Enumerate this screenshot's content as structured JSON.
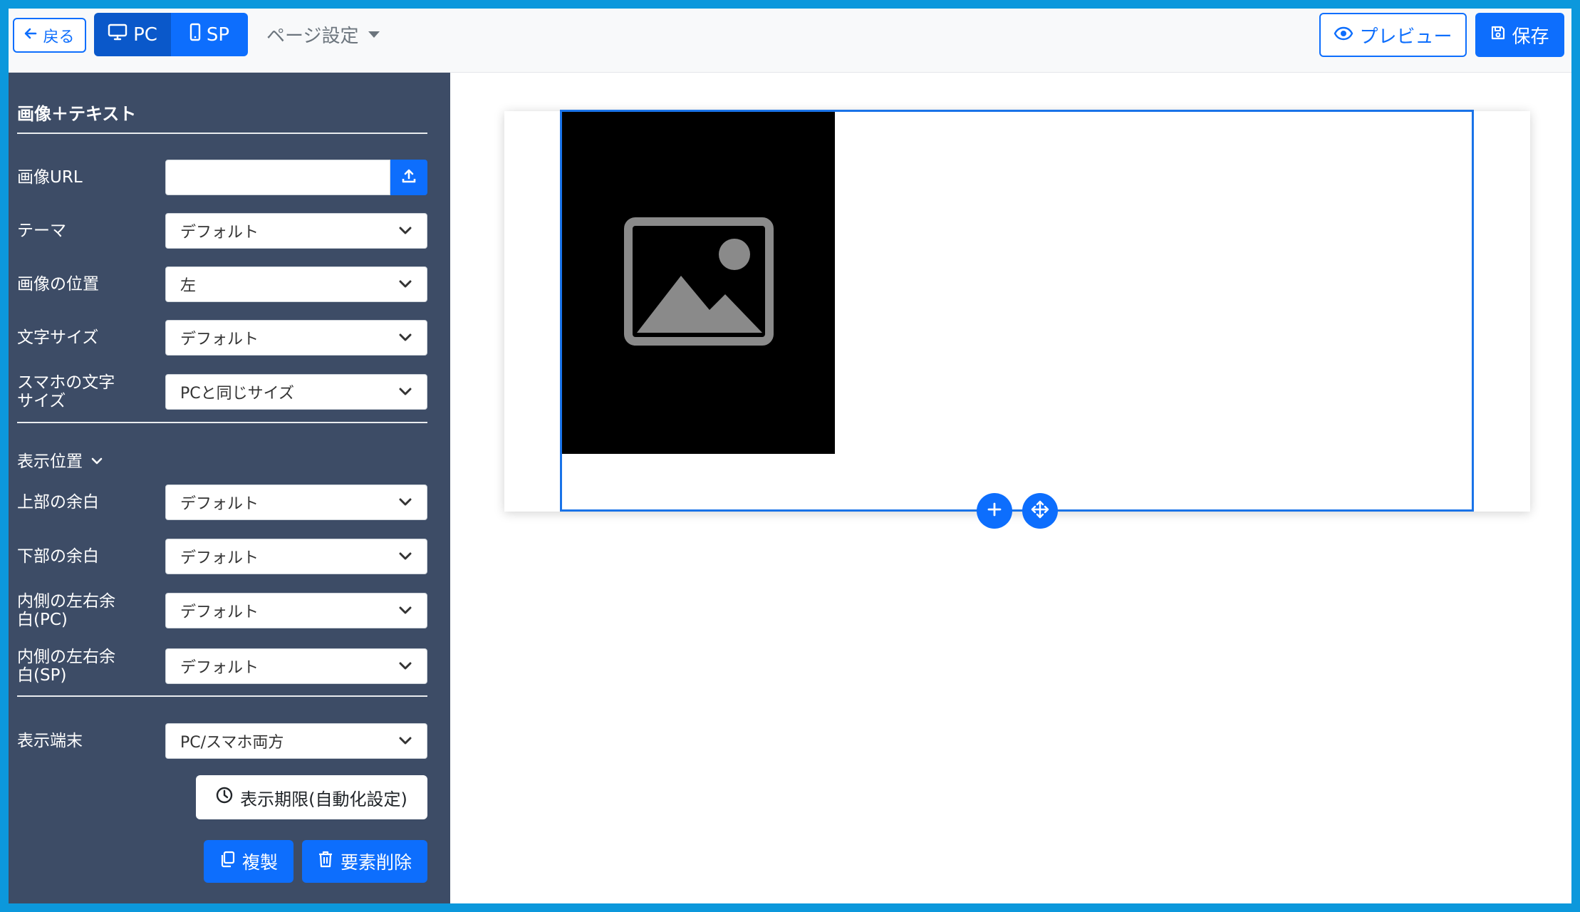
{
  "topbar": {
    "back_label": "戻る",
    "device_pc": "PC",
    "device_sp": "SP",
    "page_settings": "ページ設定",
    "preview_label": "プレビュー",
    "save_label": "保存"
  },
  "sidebar": {
    "title": "画像＋テキスト",
    "image_url": {
      "label": "画像URL",
      "value": ""
    },
    "theme": {
      "label": "テーマ",
      "value": "デフォルト"
    },
    "image_position": {
      "label": "画像の位置",
      "value": "左"
    },
    "font_size": {
      "label": "文字サイズ",
      "value": "デフォルト"
    },
    "sp_font_size": {
      "label": "スマホの文字サイズ",
      "value": "PCと同じサイズ"
    },
    "display_section": "表示位置",
    "top_margin": {
      "label": "上部の余白",
      "value": "デフォルト"
    },
    "bottom_margin": {
      "label": "下部の余白",
      "value": "デフォルト"
    },
    "inner_margin_pc": {
      "label": "内側の左右余白(PC)",
      "value": "デフォルト"
    },
    "inner_margin_sp": {
      "label": "内側の左右余白(SP)",
      "value": "デフォルト"
    },
    "display_device": {
      "label": "表示端末",
      "value": "PC/スマホ両方"
    },
    "schedule_label": "表示期限(自動化設定)",
    "duplicate_label": "複製",
    "delete_label": "要素削除"
  },
  "colors": {
    "primary": "#0d6efd",
    "sidebar_bg": "#3d4c66",
    "frame_border": "#0c98dc",
    "selection": "#1a73e8"
  },
  "icons": {
    "back": "arrow-left-icon",
    "pc": "desktop-icon",
    "sp": "mobile-icon",
    "preview": "eye-icon",
    "save": "floppy-disk-icon",
    "upload": "upload-icon",
    "schedule": "clock-icon",
    "duplicate": "copy-icon",
    "delete": "trash-icon",
    "add": "plus-icon",
    "move": "move-arrows-icon",
    "placeholder": "image-icon"
  }
}
